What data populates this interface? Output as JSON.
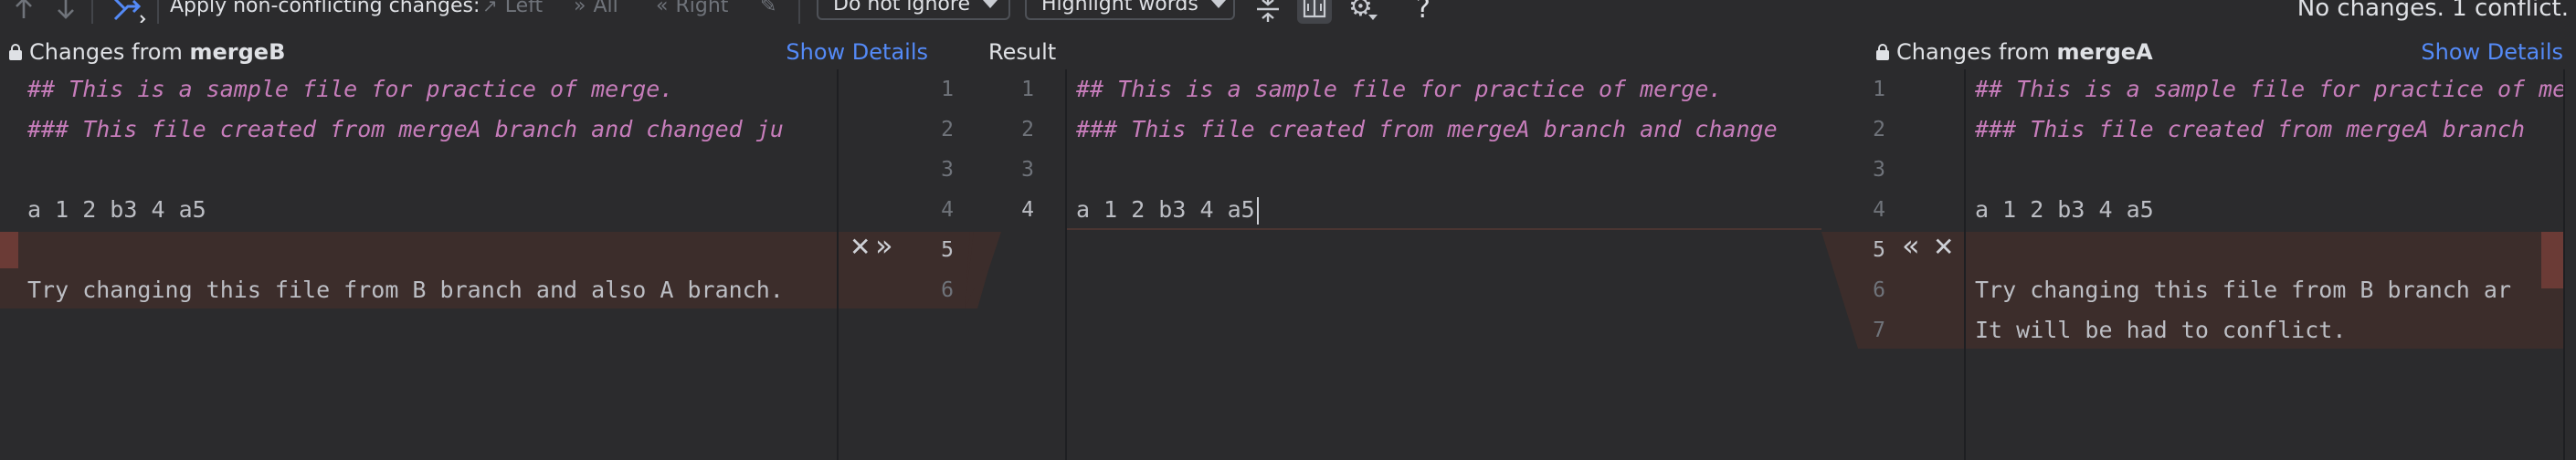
{
  "toolbar": {
    "apply_label": "Apply non-conflicting changes:",
    "left_label": "Left",
    "all_label": "All",
    "right_label": "Right",
    "ignore_select": "Do not ignore",
    "highlight_select": "Highlight words",
    "help": "?",
    "status": "No changes. 1 conflict."
  },
  "left_header": {
    "prefix": "Changes from ",
    "branch": "mergeB",
    "details": "Show Details"
  },
  "center_header": {
    "title": "Result"
  },
  "right_header": {
    "prefix": "Changes from ",
    "branch": "mergeA",
    "details": "Show Details"
  },
  "left_lines": [
    "## This is a sample file for practice of merge.",
    "### This file created from mergeA branch and changed ju",
    "",
    "a 1 2 b3 4 a5",
    "",
    "Try changing this file from B branch and also A branch."
  ],
  "center_lines": [
    "## This is a sample file for practice of merge.",
    "### This file created from mergeA branch and change",
    "",
    "a 1 2 b3 4 a5"
  ],
  "right_lines": [
    "## This is a sample file for practice of merge.",
    "### This file created from mergeA branch",
    "",
    "a 1 2 b3 4 a5",
    "",
    "Try changing this file from B branch ar",
    "It will be had to conflict."
  ],
  "left_gutter": [
    "1",
    "2",
    "3",
    "4",
    "5",
    "6"
  ],
  "result_gutter": [
    "1",
    "2",
    "3",
    "4"
  ],
  "right_gutter": [
    "1",
    "2",
    "3",
    "4",
    "5",
    "6",
    "7"
  ],
  "colors": {
    "conflict": "#3c2d2b",
    "comment": "#c77dbb",
    "link": "#548af7",
    "accent_marker": "#6b3b36"
  }
}
